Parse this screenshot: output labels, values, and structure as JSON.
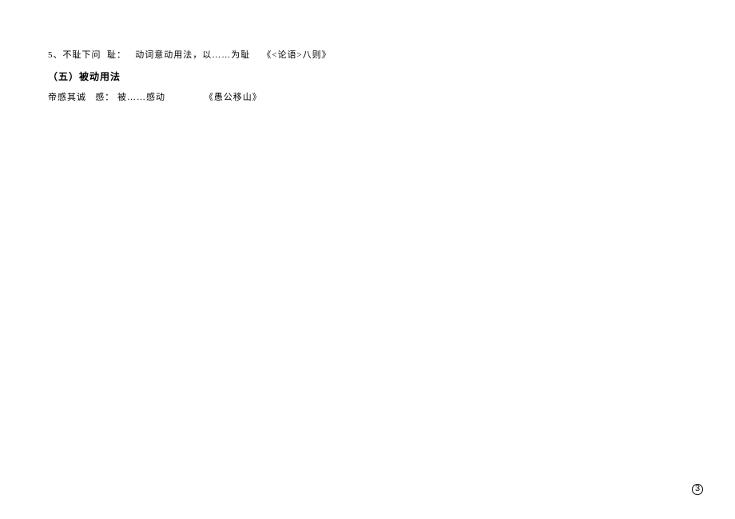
{
  "line1": {
    "index": "5、",
    "phrase": "不耻下问",
    "wordLabel": "耻：",
    "explanation": "动词意动用法，以……为耻",
    "source": "《<论语>八则》"
  },
  "heading": "（五）被动用法",
  "line2": {
    "phrase": "帝感其诚",
    "wordLabel": "感：",
    "explanation": "被……感动",
    "source": "《愚公移山》"
  },
  "pageNumber": "3"
}
